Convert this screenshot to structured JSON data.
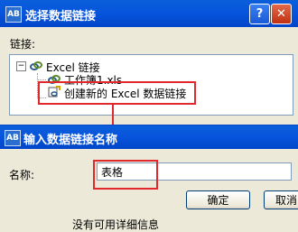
{
  "back_dialog": {
    "title": "选择数据链接",
    "icon_text": "AB",
    "help_symbol": "?",
    "close_symbol": "✕",
    "link_label": "链接:",
    "tree": {
      "root_expander": "−",
      "root_label": "Excel 链接",
      "child_label": "工作簿1.xls",
      "new_link_label": "创建新的 Excel 数据链接"
    }
  },
  "front_dialog": {
    "title": "输入数据链接名称",
    "icon_text": "AB",
    "name_label": "名称:",
    "name_value": "表格",
    "ok_label": "确定",
    "cancel_label": "取消",
    "bottom_clip": "没有可用详细信息"
  },
  "colors": {
    "title_bar": "#0855dd",
    "highlight": "#e0282d",
    "dialog_bg": "#ece9d8"
  }
}
